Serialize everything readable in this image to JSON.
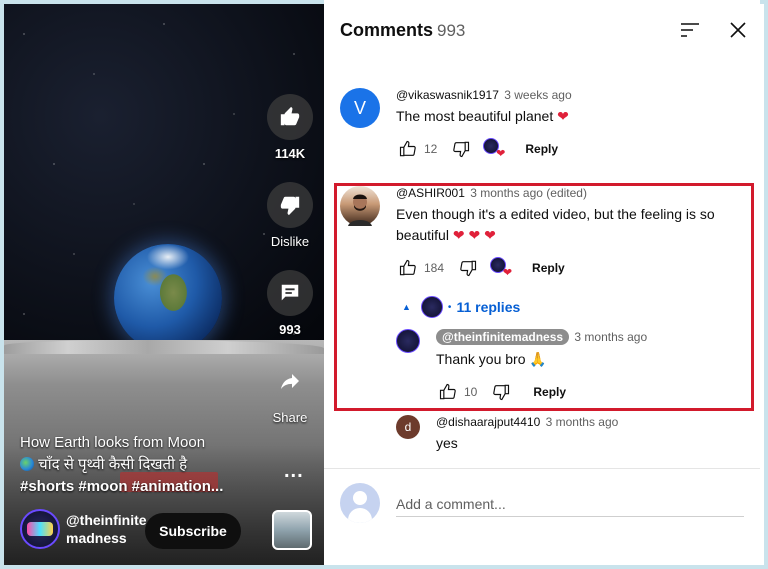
{
  "video": {
    "actions": {
      "like_count": "114K",
      "dislike_label": "Dislike",
      "comments_count": "993",
      "share_label": "Share"
    },
    "title_line1": "How Earth looks from Moon",
    "title_line2": "चाँद से पृथ्वी कैसी दिखती है",
    "hashtags": "#shorts #moon #animation...",
    "channel_name": "@theinfinite madness",
    "subscribe_label": "Subscribe",
    "more_label": "..."
  },
  "comments_panel": {
    "title": "Comments",
    "count": "993",
    "comments": [
      {
        "avatar_letter": "V",
        "avatar_color": "#1a73e8",
        "author": "@vikaswasnik1917",
        "time": "3 weeks ago",
        "text": "The most beautiful planet",
        "likes": "12",
        "reply_label": "Reply"
      },
      {
        "author": "@ASHIR001",
        "time": "3 months ago (edited)",
        "text": "Even though it's a edited video, but the feeling is so beautiful",
        "likes": "184",
        "reply_label": "Reply",
        "replies_toggle": "11 replies"
      },
      {
        "author": "@theinfinitemadness",
        "time": "3 months ago",
        "text": "Thank you bro 🙏",
        "likes": "10",
        "reply_label": "Reply"
      },
      {
        "avatar_letter": "d",
        "avatar_color": "#6d3b2c",
        "author": "@dishaarajput4410",
        "time": "3 months ago",
        "text": "yes"
      }
    ],
    "add_comment_placeholder": "Add a comment..."
  },
  "colors": {
    "highlight_border": "#d21a2c",
    "link_blue": "#065fd4",
    "heart_red": "#e0213a"
  }
}
